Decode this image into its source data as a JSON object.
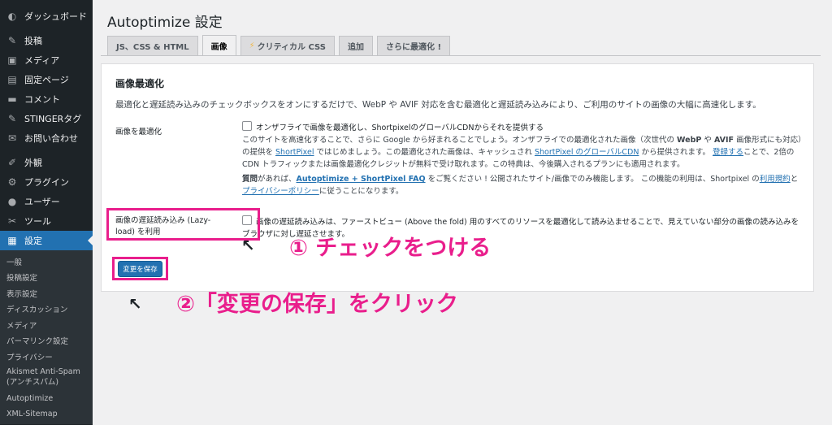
{
  "sidebar": {
    "top_items": [
      {
        "icon": "dashboard-icon",
        "glyph": "◐",
        "label": "ダッシュボード"
      },
      {
        "icon": "pin-icon",
        "glyph": "✎",
        "label": "投稿"
      },
      {
        "icon": "media-icon",
        "glyph": "▣",
        "label": "メディア"
      },
      {
        "icon": "page-icon",
        "glyph": "▤",
        "label": "固定ページ"
      },
      {
        "icon": "comment-icon",
        "glyph": "▬",
        "label": "コメント"
      },
      {
        "icon": "pin-icon",
        "glyph": "✎",
        "label": "STINGERタグ"
      },
      {
        "icon": "mail-icon",
        "glyph": "✉",
        "label": "お問い合わせ"
      },
      {
        "icon": "brush-icon",
        "glyph": "✐",
        "label": "外観"
      },
      {
        "icon": "plugin-icon",
        "glyph": "⚙",
        "label": "プラグイン"
      },
      {
        "icon": "user-icon",
        "glyph": "●",
        "label": "ユーザー"
      },
      {
        "icon": "wrench-icon",
        "glyph": "✂",
        "label": "ツール"
      },
      {
        "icon": "settings-icon",
        "glyph": "▦",
        "label": "設定"
      }
    ],
    "sub_items": [
      "一般",
      "投稿設定",
      "表示設定",
      "ディスカッション",
      "メディア",
      "パーマリンク設定",
      "プライバシー",
      "Akismet Anti-Spam (アンチスパム)",
      "Autoptimize",
      "XML-Sitemap"
    ]
  },
  "page": {
    "title": "Autoptimize 設定"
  },
  "tabs": [
    "JS、CSS & HTML",
    "画像",
    "クリティカル CSS",
    "追加",
    "さらに最適化 !"
  ],
  "panel": {
    "title": "画像最適化",
    "description": "最適化と遅延読み込みのチェックボックスをオンにするだけで、WebP や AVIF 対応を含む最適化と遅延読み込みにより、ご利用のサイトの画像の大幅に高速化します。",
    "opt_label": "画像を最適化",
    "opt_checkbox": "オンザフライで画像を最適化し、ShortpixelのグローバルCDNからそれを提供する",
    "opt_note": {
      "t1": "このサイトを高速化することで、さらに Google から好まれることでしょう。オンザフライでの最適化された画像（次世代の ",
      "webp": "WebP",
      "t2": " や ",
      "avif": "AVIF",
      "t3": " 画像形式にも対応）の提供を ",
      "shortpixel": "ShortPixel",
      "t4": " ではじめましょう。この最適化された画像は、キャッシュされ ",
      "cdn": "ShortPixel のグローバルCDN",
      "t5": " から提供されます。 ",
      "register": "登録する",
      "t6": "ことで、2倍の CDN トラフィックまたは画像最適化クレジットが無料で受け取れます。この特典は、今後購入されるプランにも適用されます。",
      "q": "質問",
      "t7": "があれば、",
      "faq": "Autoptimize + ShortPixel FAQ",
      "t8": " をご覧ください ! 公開されたサイト/画像でのみ機能します。 この機能の利用は、Shortpixel の",
      "terms": "利用規約",
      "t9": "と",
      "privacy": "プライバシーポリシー",
      "t10": "に従うことになります。"
    },
    "lazy_label": "画像の遅延読み込み (Lazy-load) を利用",
    "lazy_text": "画像の遅延読み込みは、ファーストビュー (Above the fold) 用のすべてのリソースを最適化して読み込ませることで、見えていない部分の画像の読み込みをブラウザに対し遅延させます。",
    "save_label": "変更を保存"
  },
  "annotations": {
    "step1": "① チェックをつける",
    "step2": "②「変更の保存」をクリック",
    "arrow": "↖",
    "highlight_color": "#e91e8c"
  }
}
